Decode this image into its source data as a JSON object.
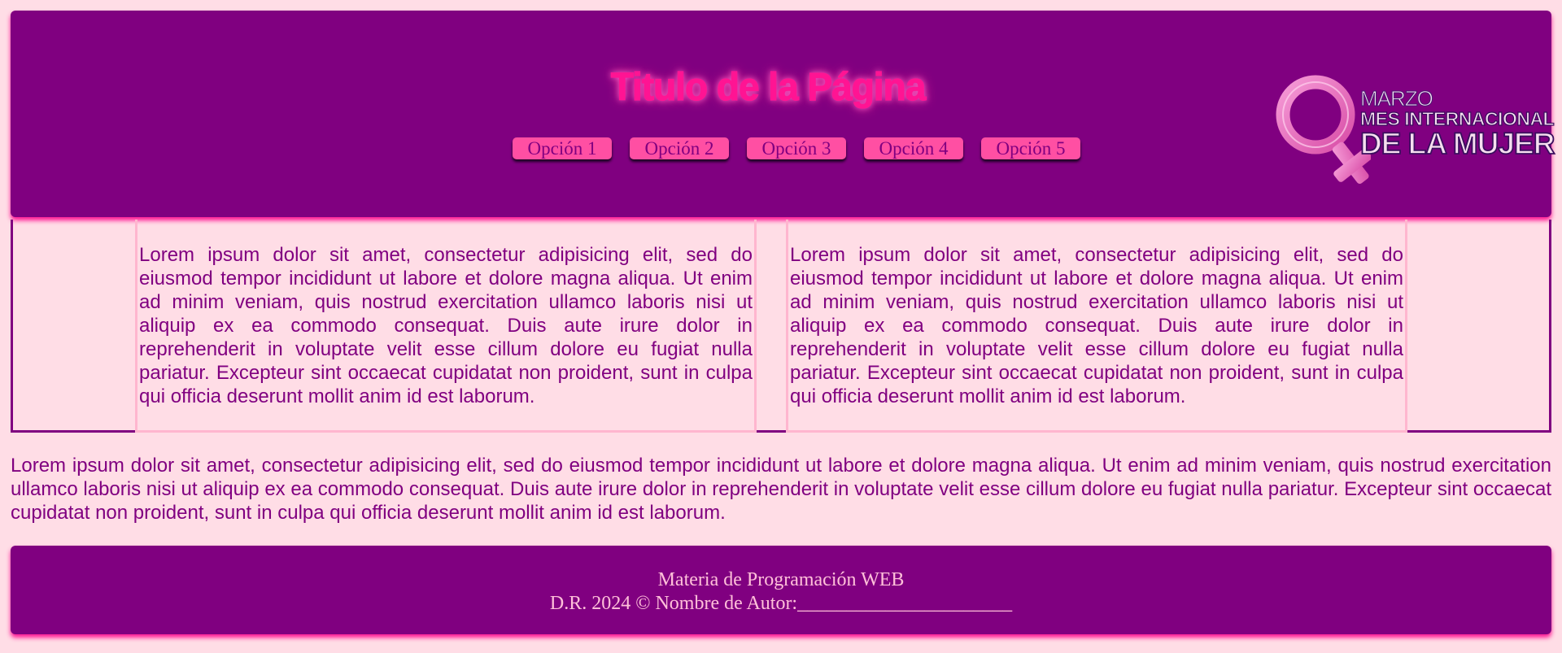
{
  "header": {
    "title": "Titulo de la Página",
    "nav": [
      {
        "label": "Opción 1"
      },
      {
        "label": "Opción 2"
      },
      {
        "label": "Opción 3"
      },
      {
        "label": "Opción 4"
      },
      {
        "label": "Opción 5"
      }
    ],
    "logo": {
      "line1": "MARZO",
      "line2": "MES INTERNACIONAL",
      "line3": "DE LA MUJER",
      "icon": "female-symbol-icon"
    }
  },
  "columns": [
    {
      "text": "Lorem ipsum dolor sit amet, consectetur adipisicing elit, sed do eiusmod tempor incididunt ut labore et dolore magna aliqua. Ut enim ad minim veniam, quis nostrud exercitation ullamco laboris nisi ut aliquip ex ea commodo consequat. Duis aute irure dolor in reprehenderit in voluptate velit esse cillum dolore eu fugiat nulla pariatur. Excepteur sint occaecat cupidatat non proident, sunt in culpa qui officia deserunt mollit anim id est laborum."
    },
    {
      "text": "Lorem ipsum dolor sit amet, consectetur adipisicing elit, sed do eiusmod tempor incididunt ut labore et dolore magna aliqua. Ut enim ad minim veniam, quis nostrud exercitation ullamco laboris nisi ut aliquip ex ea commodo consequat. Duis aute irure dolor in reprehenderit in voluptate velit esse cillum dolore eu fugiat nulla pariatur. Excepteur sint occaecat cupidatat non proident, sunt in culpa qui officia deserunt mollit anim id est laborum."
    }
  ],
  "paragraph": "Lorem ipsum dolor sit amet, consectetur adipisicing elit, sed do eiusmod tempor incididunt ut labore et dolore magna aliqua. Ut enim ad minim veniam, quis nostrud exercitation ullamco laboris nisi ut aliquip ex ea commodo consequat. Duis aute irure dolor in reprehenderit in voluptate velit esse cillum dolore eu fugiat nulla pariatur. Excepteur sint occaecat cupidatat non proident, sunt in culpa qui officia deserunt mollit anim id est laborum.",
  "footer": {
    "line1": "Materia de Programación WEB",
    "line2": "D.R. 2024 © Nombre de Autor:______________________"
  },
  "colors": {
    "background": "#ffdde6",
    "primary": "#800080",
    "accent": "#ff1493",
    "button": "#ff4fa3",
    "column_border": "#ffb6cf"
  }
}
